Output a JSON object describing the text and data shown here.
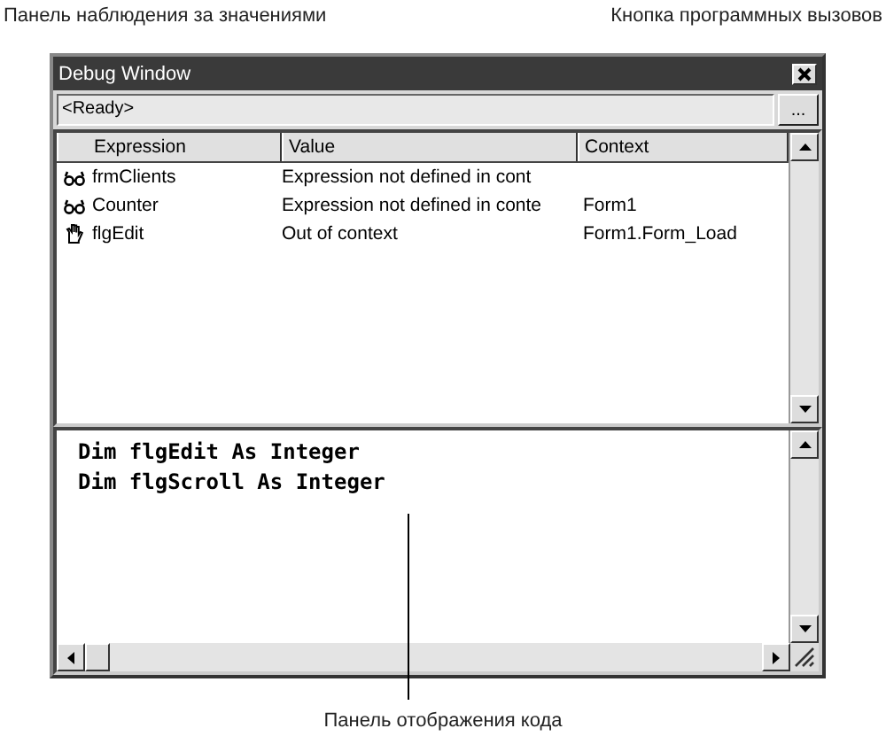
{
  "callouts": {
    "watch_panel": "Панель наблюдения за значениями",
    "calls_button": "Кнопка программных вызовов",
    "code_panel": "Панель отображения кода"
  },
  "window": {
    "title": "Debug Window",
    "status": "<Ready>",
    "calls_button": "..."
  },
  "watch": {
    "columns": [
      "Expression",
      "Value",
      "Context"
    ],
    "rows": [
      {
        "kind": "watch",
        "expression": "frmClients",
        "value": "Expression not defined in cont",
        "context": ""
      },
      {
        "kind": "watch",
        "expression": "Counter",
        "value": "Expression not defined in conte",
        "context": "Form1"
      },
      {
        "kind": "break",
        "expression": "flgEdit",
        "value": "Out of context",
        "context": "Form1.Form_Load"
      }
    ]
  },
  "code": [
    "Dim flgEdit As Integer",
    "Dim flgScroll As Integer"
  ]
}
